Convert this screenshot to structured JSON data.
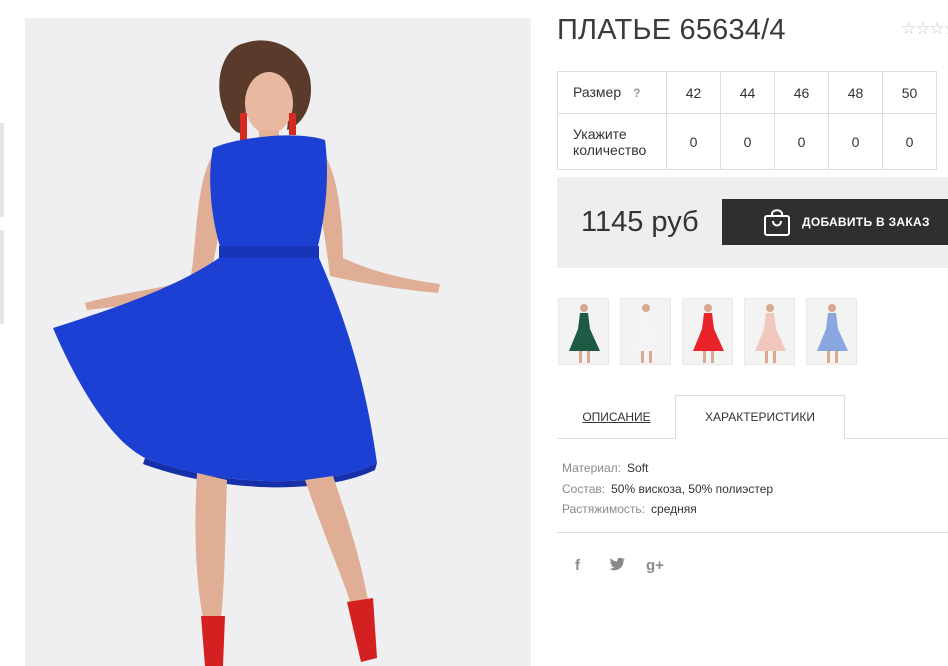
{
  "product": {
    "title": "ПЛАТЬЕ 65634/4",
    "rating_stars": "☆☆☆☆☆"
  },
  "size_table": {
    "size_label": "Размер",
    "help_mark": "?",
    "qty_label_line1": "Укажите",
    "qty_label_line2": "количество",
    "sizes": [
      "42",
      "44",
      "46",
      "48",
      "50"
    ],
    "quantities": [
      "0",
      "0",
      "0",
      "0",
      "0"
    ]
  },
  "purchase": {
    "price": "1145 руб",
    "add_button": "ДОБАВИТЬ В ЗАКАЗ"
  },
  "thumbnails": [
    {
      "color": "#1f5a45"
    },
    {
      "color": "#f4f4f4"
    },
    {
      "color": "#e8232a"
    },
    {
      "color": "#f2c7bd"
    },
    {
      "color": "#8aa6e0"
    }
  ],
  "tabs": {
    "description": "ОПИСАНИЕ",
    "characteristics": "ХАРАКТЕРИСТИКИ"
  },
  "specs": [
    {
      "key": "Материал:",
      "value": "Soft"
    },
    {
      "key": "Состав:",
      "value": "50% вискоза, 50% полиэстер"
    },
    {
      "key": "Растяжимость:",
      "value": "средняя"
    }
  ],
  "social": {
    "facebook": "f",
    "twitter": "🐦",
    "google_plus": "g+"
  },
  "colors": {
    "dress": "#1c3fd4",
    "button": "#2f2f2f",
    "price_bg": "#eeeeee"
  }
}
